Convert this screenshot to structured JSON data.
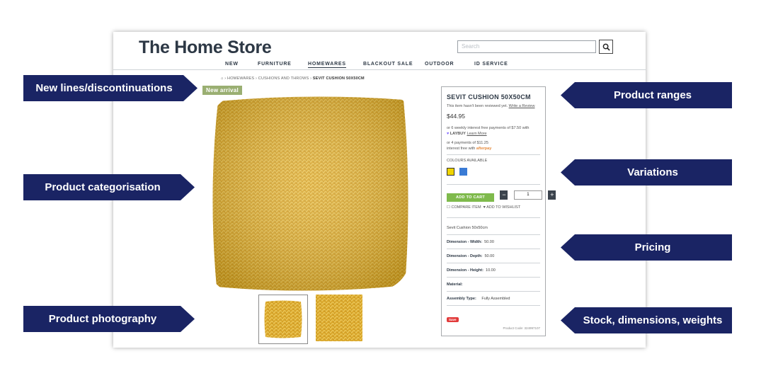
{
  "store": {
    "logo": "The Home Store",
    "search_placeholder": "Search",
    "nav": [
      "NEW",
      "FURNITURE",
      "HOMEWARES",
      "BLACKOUT SALE",
      "OUTDOOR",
      "ID SERVICE"
    ],
    "active_nav": "HOMEWARES",
    "breadcrumb": [
      "HOMEWARES",
      "CUSHIONS AND THROWS",
      "SEVIT CUSHION 50X50CM"
    ],
    "badge": "New arrival"
  },
  "product": {
    "title": "SEVIT CUSHION 50X50CM",
    "review_text": "This item hasn't been reviewed yet.",
    "review_link": "Write a Review",
    "price": "$44.95",
    "laybuy_line1": "or 6 weekly interest free payments of $7.50 with",
    "laybuy_brand": "LAYBUY",
    "laybuy_link": "Learn More",
    "afterpay_line1": "or 4 payments of $11.25",
    "afterpay_line2": "interest free with",
    "afterpay_brand": "afterpay",
    "colours_label": "COLOURS AVAILABLE",
    "colours": [
      "#f0d400",
      "#3a7bd5"
    ],
    "add_to_cart": "ADD TO CART",
    "qty_minus": "−",
    "qty_value": "1",
    "qty_plus": "+",
    "compare": "COMPARE ITEM",
    "wishlist": "ADD TO WISHLIST",
    "specs_title": "Sevit Cushion 50x50cm",
    "specs": [
      {
        "label": "Dimension - Width:",
        "value": "50.00"
      },
      {
        "label": "Dimension - Depth:",
        "value": "50.00"
      },
      {
        "label": "Dimension - Height:",
        "value": "10.00"
      },
      {
        "label": "Material:",
        "value": ""
      },
      {
        "label": "Assembly Type:",
        "value": "Fully Assembled"
      }
    ],
    "save_badge": "Save",
    "product_code": "Product Code: 324997107"
  },
  "callouts": {
    "left": [
      "New lines/discontinuations",
      "Product categorisation",
      "Product photography"
    ],
    "right": [
      "Product ranges",
      "Variations",
      "Pricing",
      "Stock, dimensions, weights"
    ]
  },
  "colors": {
    "callout_bg": "#1a2464",
    "cushion": "#d9a82a",
    "add_to_cart": "#7fba4c"
  }
}
